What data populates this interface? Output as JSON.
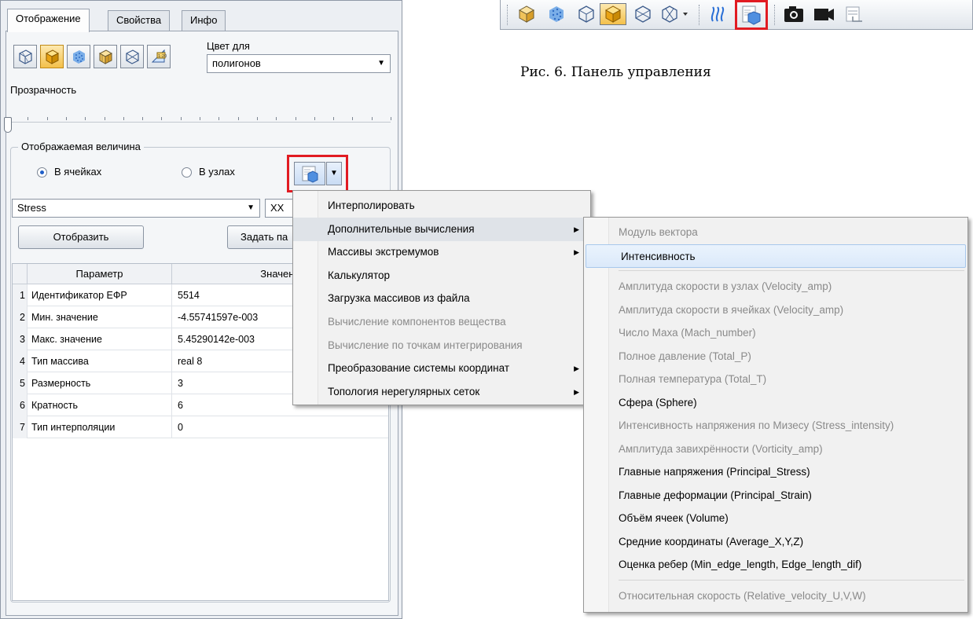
{
  "panel": {
    "tabs": [
      {
        "label": "Отображение"
      },
      {
        "label": "Свойства"
      },
      {
        "label": "Инфо"
      }
    ],
    "color_for_label": "Цвет для",
    "color_for_value": "полигонов",
    "transparency_label": "Прозрачность",
    "displayed_value_label": "Отображаемая величина",
    "radio_cells": "В ячейках",
    "radio_nodes": "В узлах",
    "array_select": "Stress",
    "component_select": "XX",
    "show_button": "Отобразить",
    "params_button": "Задать па",
    "table": {
      "headers": [
        "Параметр",
        "Значени"
      ],
      "rows": [
        {
          "n": "1",
          "param": "Идентификатор ЕФР",
          "value": "5514"
        },
        {
          "n": "2",
          "param": "Мин. значение",
          "value": "-4.55741597e-003"
        },
        {
          "n": "3",
          "param": "Макс. значение",
          "value": "5.45290142e-003"
        },
        {
          "n": "4",
          "param": "Тип массива",
          "value": "real 8"
        },
        {
          "n": "5",
          "param": "Размерность",
          "value": "3"
        },
        {
          "n": "6",
          "param": "Кратность",
          "value": "6"
        },
        {
          "n": "7",
          "param": "Тип интерполяции",
          "value": "0"
        }
      ]
    }
  },
  "caption": "Рис. 6. Панель управления",
  "menu1": {
    "items": [
      {
        "label": "Интерполировать",
        "disabled": false
      },
      {
        "label": "Дополнительные вычисления",
        "disabled": false,
        "submenu": true
      },
      {
        "label": "Массивы экстремумов",
        "disabled": false,
        "submenu": true
      },
      {
        "label": "Калькулятор",
        "disabled": false
      },
      {
        "label": "Загрузка массивов из файла",
        "disabled": false
      },
      {
        "label": "Вычисление компонентов вещества",
        "disabled": true
      },
      {
        "label": "Вычисление по точкам интегрирования",
        "disabled": true
      },
      {
        "label": "Преобразование системы координат",
        "disabled": false,
        "submenu": true
      },
      {
        "label": "Топология нерегулярных сеток",
        "disabled": false,
        "submenu": true
      }
    ]
  },
  "menu2": {
    "items": [
      {
        "label": "Модуль вектора",
        "disabled": true
      },
      {
        "label": "Интенсивность",
        "disabled": false,
        "highlighted": true
      },
      {
        "label": "Амплитуда скорости в узлах (Velocity_amp)",
        "disabled": true
      },
      {
        "label": "Амплитуда скорости в ячейках (Velocity_amp)",
        "disabled": true
      },
      {
        "label": "Число Маха (Mach_number)",
        "disabled": true
      },
      {
        "label": "Полное давление (Total_P)",
        "disabled": true
      },
      {
        "label": "Полная температура (Total_T)",
        "disabled": true
      },
      {
        "label": "Сфера (Sphere)",
        "disabled": false
      },
      {
        "label": "Интенсивность напряжения по Мизесу (Stress_intensity)",
        "disabled": true
      },
      {
        "label": "Амплитуда завихрённости (Vorticity_amp)",
        "disabled": true
      },
      {
        "label": "Главные напряжения (Principal_Stress)",
        "disabled": false
      },
      {
        "label": "Главные деформации (Principal_Strain)",
        "disabled": false
      },
      {
        "label": "Объём ячеек (Volume)",
        "disabled": false
      },
      {
        "label": "Средние координаты (Average_X,Y,Z)",
        "disabled": false
      },
      {
        "label": "Оценка ребер (Min_edge_length, Edge_length_dif)",
        "disabled": false
      },
      {
        "label": "Относительная скорость (Relative_velocity_U,V,W)",
        "disabled": true
      }
    ]
  },
  "icons": {
    "mode_buttons": [
      "wireframe-cube-icon",
      "solid-cube-icon",
      "points-cube-icon",
      "shaded-cube-icon",
      "edges-cube-icon",
      "scale-icon"
    ],
    "toolbar": [
      "shaded-cube-icon",
      "points-cube-icon",
      "wireframe-cube-icon",
      "solid-cube-icon",
      "edges-cube-icon",
      "mesh-dropdown-icon",
      "streamlines-icon",
      "field-array-icon",
      "camera-icon",
      "video-icon",
      "export-icon"
    ]
  },
  "colors": {
    "highlight_red": "#e11b22",
    "cube_yellow": "#f3c04a",
    "cube_blue": "#4f8fe0"
  }
}
